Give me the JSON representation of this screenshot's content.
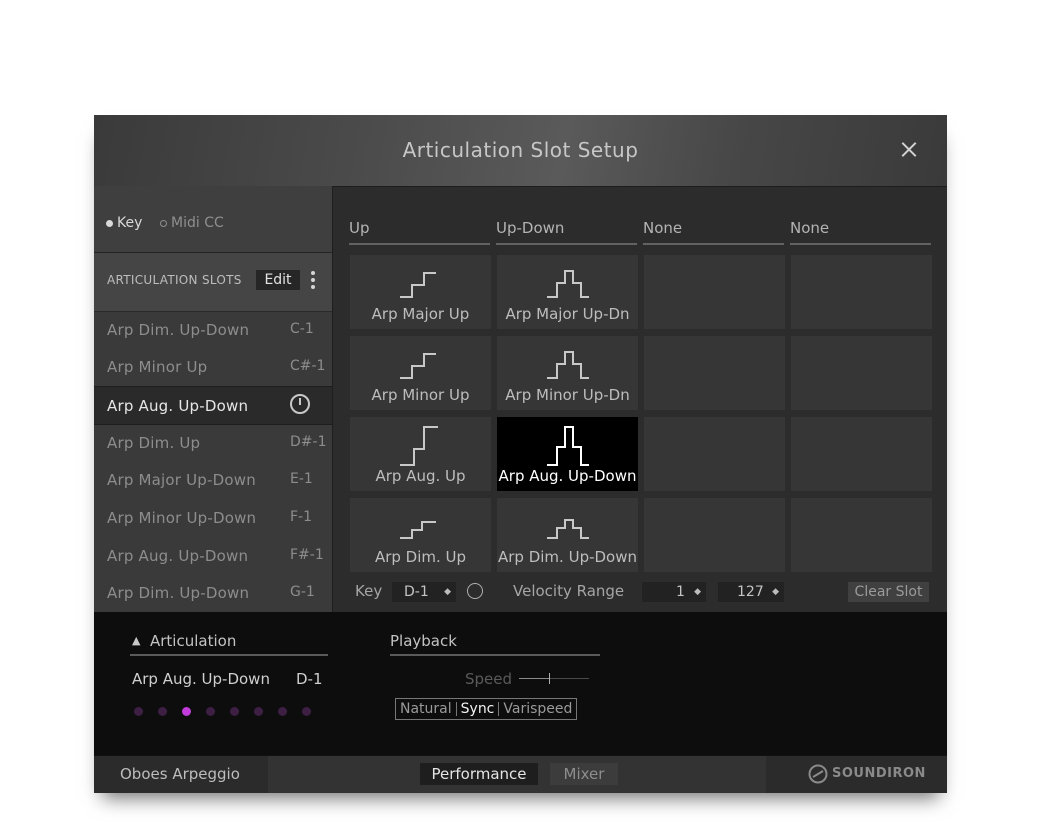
{
  "window": {
    "title": "Articulation Slot Setup"
  },
  "mode": {
    "key_label": "Key",
    "midicc_label": "Midi CC"
  },
  "slots_header": {
    "label": "ARTICULATION SLOTS",
    "edit_label": "Edit"
  },
  "slots": [
    {
      "name": "Arp Dim. Up-Down",
      "key": "C-1"
    },
    {
      "name": "Arp Minor Up",
      "key": "C#-1"
    },
    {
      "name": "Arp Aug. Up-Down",
      "key": ""
    },
    {
      "name": "Arp Dim. Up",
      "key": "D#-1"
    },
    {
      "name": "Arp Major Up-Down",
      "key": "E-1"
    },
    {
      "name": "Arp Minor Up-Down",
      "key": "F-1"
    },
    {
      "name": "Arp Aug. Up-Down",
      "key": "F#-1"
    },
    {
      "name": "Arp Dim. Up-Down",
      "key": "G-1"
    }
  ],
  "columns": [
    "Up",
    "Up-Down",
    "None",
    "None"
  ],
  "grid": [
    [
      "Arp Major Up",
      "Arp Major Up-Dn"
    ],
    [
      "Arp Minor Up",
      "Arp Minor Up-Dn"
    ],
    [
      "Arp Aug. Up",
      "Arp Aug. Up-Down"
    ],
    [
      "Arp Dim. Up",
      "Arp Dim. Up-Down"
    ]
  ],
  "controls": {
    "key_label": "Key",
    "key_value": "D-1",
    "velocity_label": "Velocity Range",
    "vel_min": "1",
    "vel_max": "127",
    "clear_label": "Clear Slot"
  },
  "articulation": {
    "header": "Articulation",
    "current_name": "Arp Aug. Up-Down",
    "current_key": "D-1",
    "active_dot": 3,
    "dot_count": 8
  },
  "playback": {
    "header": "Playback",
    "speed_label": "Speed",
    "modes": [
      "Natural",
      "Sync",
      "Varispeed"
    ],
    "selected_mode": "Sync"
  },
  "footer": {
    "preset": "Oboes Arpeggio",
    "tab_performance": "Performance",
    "tab_mixer": "Mixer",
    "brand": "SOUNDIRON"
  },
  "colors": {
    "accent": "#c23bdb",
    "active_cell": "#000000",
    "panel": "#2c2c2c"
  }
}
